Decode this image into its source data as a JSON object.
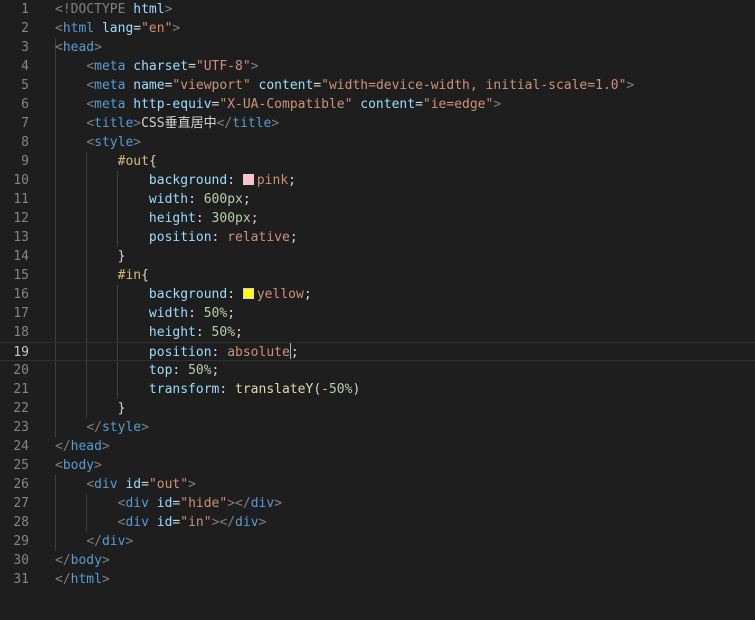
{
  "editor": {
    "current_line": 19,
    "lines": [
      {
        "n": "1",
        "tokens": [
          {
            "t": "<!DOCTYPE ",
            "c": 0
          },
          {
            "t": "html",
            "c": 2
          },
          {
            "t": ">",
            "c": 0
          }
        ]
      },
      {
        "n": "2",
        "tokens": [
          {
            "t": "<",
            "c": 0
          },
          {
            "t": "html",
            "c": 1
          },
          {
            "t": " lang",
            "c": 2
          },
          {
            "t": "=",
            "c": 4
          },
          {
            "t": "\"en\"",
            "c": 3
          },
          {
            "t": ">",
            "c": 0
          }
        ]
      },
      {
        "n": "3",
        "tokens": [
          {
            "t": "<",
            "c": 0
          },
          {
            "t": "head",
            "c": 1
          },
          {
            "t": ">",
            "c": 0
          }
        ]
      },
      {
        "n": "4",
        "tokens": [
          {
            "t": "    "
          },
          {
            "t": "<",
            "c": 0
          },
          {
            "t": "meta",
            "c": 1
          },
          {
            "t": " charset",
            "c": 2
          },
          {
            "t": "=",
            "c": 4
          },
          {
            "t": "\"UTF-8\"",
            "c": 3
          },
          {
            "t": ">",
            "c": 0
          }
        ]
      },
      {
        "n": "5",
        "tokens": [
          {
            "t": "    "
          },
          {
            "t": "<",
            "c": 0
          },
          {
            "t": "meta",
            "c": 1
          },
          {
            "t": " name",
            "c": 2
          },
          {
            "t": "=",
            "c": 4
          },
          {
            "t": "\"viewport\"",
            "c": 3
          },
          {
            "t": " content",
            "c": 2
          },
          {
            "t": "=",
            "c": 4
          },
          {
            "t": "\"width=device-width, initial-scale=1.0\"",
            "c": 3
          },
          {
            "t": ">",
            "c": 0
          }
        ]
      },
      {
        "n": "6",
        "tokens": [
          {
            "t": "    "
          },
          {
            "t": "<",
            "c": 0
          },
          {
            "t": "meta",
            "c": 1
          },
          {
            "t": " http-equiv",
            "c": 2
          },
          {
            "t": "=",
            "c": 4
          },
          {
            "t": "\"X-UA-Compatible\"",
            "c": 3
          },
          {
            "t": " content",
            "c": 2
          },
          {
            "t": "=",
            "c": 4
          },
          {
            "t": "\"ie=edge\"",
            "c": 3
          },
          {
            "t": ">",
            "c": 0
          }
        ]
      },
      {
        "n": "7",
        "tokens": [
          {
            "t": "    "
          },
          {
            "t": "<",
            "c": 0
          },
          {
            "t": "title",
            "c": 1
          },
          {
            "t": ">",
            "c": 0
          },
          {
            "t": "CSS垂直居中",
            "c": 4
          },
          {
            "t": "</",
            "c": 0
          },
          {
            "t": "title",
            "c": 1
          },
          {
            "t": ">",
            "c": 0
          }
        ]
      },
      {
        "n": "8",
        "tokens": [
          {
            "t": "    "
          },
          {
            "t": "<",
            "c": 0
          },
          {
            "t": "style",
            "c": 1
          },
          {
            "t": ">",
            "c": 0
          }
        ]
      },
      {
        "n": "9",
        "tokens": [
          {
            "t": "        "
          },
          {
            "t": "#out",
            "c": 5
          },
          {
            "t": "{",
            "c": 4
          }
        ]
      },
      {
        "n": "10",
        "tokens": [
          {
            "t": "            "
          },
          {
            "t": "background",
            "c": 2
          },
          {
            "t": ": ",
            "c": 4
          },
          {
            "swatch": "#ffc0cb"
          },
          {
            "t": "pink",
            "c": 3
          },
          {
            "t": ";",
            "c": 4
          }
        ]
      },
      {
        "n": "11",
        "tokens": [
          {
            "t": "            "
          },
          {
            "t": "width",
            "c": 2
          },
          {
            "t": ": ",
            "c": 4
          },
          {
            "t": "600px",
            "c": 6
          },
          {
            "t": ";",
            "c": 4
          }
        ]
      },
      {
        "n": "12",
        "tokens": [
          {
            "t": "            "
          },
          {
            "t": "height",
            "c": 2
          },
          {
            "t": ": ",
            "c": 4
          },
          {
            "t": "300px",
            "c": 6
          },
          {
            "t": ";",
            "c": 4
          }
        ]
      },
      {
        "n": "13",
        "tokens": [
          {
            "t": "            "
          },
          {
            "t": "position",
            "c": 2
          },
          {
            "t": ": ",
            "c": 4
          },
          {
            "t": "relative",
            "c": 3
          },
          {
            "t": ";",
            "c": 4
          }
        ]
      },
      {
        "n": "14",
        "tokens": [
          {
            "t": "        "
          },
          {
            "t": "}",
            "c": 4
          }
        ]
      },
      {
        "n": "15",
        "tokens": [
          {
            "t": "        "
          },
          {
            "t": "#in",
            "c": 5
          },
          {
            "t": "{",
            "c": 4
          }
        ]
      },
      {
        "n": "16",
        "tokens": [
          {
            "t": "            "
          },
          {
            "t": "background",
            "c": 2
          },
          {
            "t": ": ",
            "c": 4
          },
          {
            "swatch": "#ffff00"
          },
          {
            "t": "yellow",
            "c": 3
          },
          {
            "t": ";",
            "c": 4
          }
        ]
      },
      {
        "n": "17",
        "tokens": [
          {
            "t": "            "
          },
          {
            "t": "width",
            "c": 2
          },
          {
            "t": ": ",
            "c": 4
          },
          {
            "t": "50%",
            "c": 6
          },
          {
            "t": ";",
            "c": 4
          }
        ]
      },
      {
        "n": "18",
        "tokens": [
          {
            "t": "            "
          },
          {
            "t": "height",
            "c": 2
          },
          {
            "t": ": ",
            "c": 4
          },
          {
            "t": "50%",
            "c": 6
          },
          {
            "t": ";",
            "c": 4
          }
        ]
      },
      {
        "n": "19",
        "tokens": [
          {
            "t": "            "
          },
          {
            "t": "position",
            "c": 2
          },
          {
            "t": ": ",
            "c": 4
          },
          {
            "t": "absolute",
            "c": 3
          },
          {
            "cursor": true
          },
          {
            "t": ";",
            "c": 4
          }
        ]
      },
      {
        "n": "20",
        "tokens": [
          {
            "t": "            "
          },
          {
            "t": "top",
            "c": 2
          },
          {
            "t": ": ",
            "c": 4
          },
          {
            "t": "50%",
            "c": 6
          },
          {
            "t": ";",
            "c": 4
          }
        ]
      },
      {
        "n": "21",
        "tokens": [
          {
            "t": "            "
          },
          {
            "t": "transform",
            "c": 2
          },
          {
            "t": ": ",
            "c": 4
          },
          {
            "t": "translateY",
            "c": 7
          },
          {
            "t": "(",
            "c": 4
          },
          {
            "t": "-50%",
            "c": 6
          },
          {
            "t": ")",
            "c": 4
          }
        ]
      },
      {
        "n": "22",
        "tokens": [
          {
            "t": "        "
          },
          {
            "t": "}",
            "c": 4
          }
        ]
      },
      {
        "n": "23",
        "tokens": [
          {
            "t": "    "
          },
          {
            "t": "</",
            "c": 0
          },
          {
            "t": "style",
            "c": 1
          },
          {
            "t": ">",
            "c": 0
          }
        ]
      },
      {
        "n": "24",
        "tokens": [
          {
            "t": "</",
            "c": 0
          },
          {
            "t": "head",
            "c": 1
          },
          {
            "t": ">",
            "c": 0
          }
        ]
      },
      {
        "n": "25",
        "tokens": [
          {
            "t": "<",
            "c": 0
          },
          {
            "t": "body",
            "c": 1
          },
          {
            "t": ">",
            "c": 0
          }
        ]
      },
      {
        "n": "26",
        "tokens": [
          {
            "t": "    "
          },
          {
            "t": "<",
            "c": 0
          },
          {
            "t": "div",
            "c": 1
          },
          {
            "t": " id",
            "c": 2
          },
          {
            "t": "=",
            "c": 4
          },
          {
            "t": "\"out\"",
            "c": 3
          },
          {
            "t": ">",
            "c": 0
          }
        ]
      },
      {
        "n": "27",
        "tokens": [
          {
            "t": "        "
          },
          {
            "t": "<",
            "c": 0
          },
          {
            "t": "div",
            "c": 1
          },
          {
            "t": " id",
            "c": 2
          },
          {
            "t": "=",
            "c": 4
          },
          {
            "t": "\"hide\"",
            "c": 3
          },
          {
            "t": "></",
            "c": 0
          },
          {
            "t": "div",
            "c": 1
          },
          {
            "t": ">",
            "c": 0
          }
        ]
      },
      {
        "n": "28",
        "tokens": [
          {
            "t": "        "
          },
          {
            "t": "<",
            "c": 0
          },
          {
            "t": "div",
            "c": 1
          },
          {
            "t": " id",
            "c": 2
          },
          {
            "t": "=",
            "c": 4
          },
          {
            "t": "\"in\"",
            "c": 3
          },
          {
            "t": "></",
            "c": 0
          },
          {
            "t": "div",
            "c": 1
          },
          {
            "t": ">",
            "c": 0
          }
        ]
      },
      {
        "n": "29",
        "tokens": [
          {
            "t": "    "
          },
          {
            "t": "</",
            "c": 0
          },
          {
            "t": "div",
            "c": 1
          },
          {
            "t": ">",
            "c": 0
          }
        ]
      },
      {
        "n": "30",
        "tokens": [
          {
            "t": "</",
            "c": 0
          },
          {
            "t": "body",
            "c": 1
          },
          {
            "t": ">",
            "c": 0
          }
        ]
      },
      {
        "n": "31",
        "tokens": [
          {
            "t": "</",
            "c": 0
          },
          {
            "t": "html",
            "c": 1
          },
          {
            "t": ">",
            "c": 0
          }
        ]
      }
    ]
  }
}
